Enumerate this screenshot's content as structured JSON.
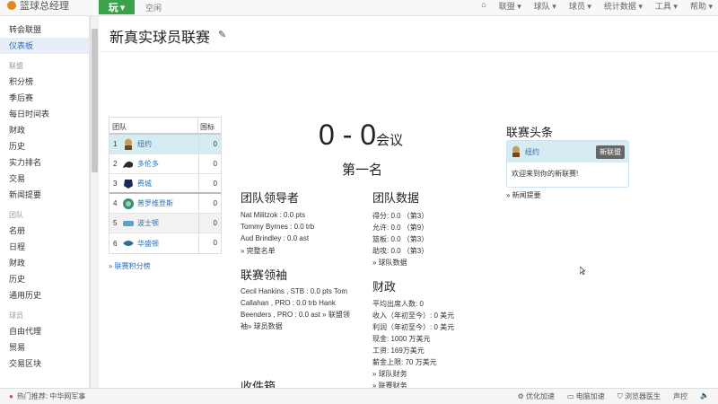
{
  "topbar": {
    "brand": "篮球总经理",
    "play_label": "玩",
    "hint": "空闲",
    "menu": [
      "联盟",
      "球队",
      "球员",
      "统计数据",
      "工具",
      "帮助"
    ]
  },
  "sidebar": {
    "top_items": [
      "转会联盟",
      "仪表板"
    ],
    "sections": [
      {
        "header": "联盟",
        "items": [
          "积分榜",
          "季后赛",
          "每日时间表",
          "财政",
          "历史",
          "实力排名",
          "交易",
          "新闻提要"
        ]
      },
      {
        "header": "团队",
        "items": [
          "名册",
          "日程",
          "财政",
          "历史",
          "通用历史"
        ]
      },
      {
        "header": "球员",
        "items": [
          "自由代理",
          "贸易",
          "交易区块"
        ]
      }
    ]
  },
  "page": {
    "title": "新真实球员联赛"
  },
  "standings": {
    "col_team": "团队",
    "col_gb": "国标",
    "rows": [
      {
        "rank": "1",
        "team": "纽约",
        "gb": "0",
        "icon": "nyk-logo-icon",
        "color": "#c89b50"
      },
      {
        "rank": "2",
        "team": "多伦多",
        "gb": "0",
        "icon": "tor-logo-icon",
        "color": "#2b2b2b"
      },
      {
        "rank": "3",
        "team": "费城",
        "gb": "0",
        "icon": "phi-logo-icon",
        "color": "#1b2a55"
      },
      {
        "rank": "4",
        "team": "普罗维登斯",
        "gb": "0",
        "icon": "pro-logo-icon",
        "color": "#3a8d7a"
      },
      {
        "rank": "5",
        "team": "波士顿",
        "gb": "0",
        "icon": "bos-logo-icon",
        "color": "#5aa2c8"
      },
      {
        "rank": "6",
        "team": "华盛顿",
        "gb": "0",
        "icon": "was-logo-icon",
        "color": "#2f6f8f"
      }
    ],
    "link": "» 联赛积分榜"
  },
  "summary": {
    "record": "0 - 0",
    "conf": "会议",
    "place": "第一名"
  },
  "team_leaders": {
    "title": "团队领导者",
    "lines": [
      "Nat Militzok : 0.0 pts",
      "Tommy Byrnes : 0.0 trb",
      "Aud Brindley : 0.0 ast"
    ],
    "link": "» 完整名单"
  },
  "league_leaders": {
    "title": "联赛领袖",
    "text": "Cecil Hankins , STB : 0.0 pts Tom Callahan , PRO : 0.0 trb Hank Beenders , PRO : 0.0 ast » 联盟领袖» 球员数据"
  },
  "inbox": {
    "title": "收件箱"
  },
  "team_stats": {
    "title": "团队数据",
    "lines": [
      "得分: 0.0 （第3）",
      "允许: 0.0 （第9）",
      "篮板: 0.0 （第3）",
      "助攻: 0.0 （第3）"
    ],
    "link": "» 球队数据"
  },
  "finances": {
    "title": "财政",
    "lines": [
      "平均出席人数: 0",
      "收入（年初至今）: 0 美元",
      "利润（年初至今）: 0 美元",
      "现金: 1000 万美元",
      "工资: 169万美元",
      "薪金上限: 70 万美元"
    ],
    "link1": "» 球队财务",
    "link2": "» 联赛财务"
  },
  "headlines": {
    "title": "联赛头条",
    "team": "纽约",
    "badge": "新联盟",
    "message": "欢迎来到你的新联赛!",
    "link": "» 新闻提要"
  },
  "statusbar": {
    "left": "热门推荐: 中华网军事",
    "right": [
      "优化加速",
      "电脑加速",
      "浏览器医生",
      "声控"
    ]
  }
}
